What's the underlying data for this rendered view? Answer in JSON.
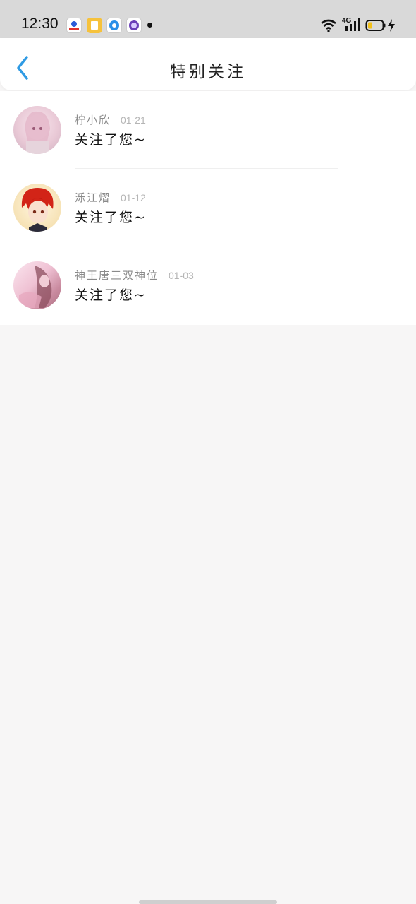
{
  "status_bar": {
    "time": "12:30",
    "network": "4G",
    "icons": [
      "baidu-app-icon",
      "notes-app-icon",
      "browser-app-icon",
      "messenger-app-icon",
      "wifi-icon",
      "cellular-signal-icon",
      "battery-icon",
      "charging-icon"
    ]
  },
  "header": {
    "title": "特别关注",
    "back_icon": "chevron-left-icon"
  },
  "colors": {
    "accent": "#2f9be4",
    "background": "#f7f6f6",
    "status_bar": "#d9d9d9"
  },
  "items": [
    {
      "name": "柠小欣",
      "date": "01-21",
      "message": "关注了您~",
      "avatar": "avatar-pink-hair"
    },
    {
      "name": "泺江熠",
      "date": "01-12",
      "message": "关注了您~",
      "avatar": "avatar-red-hair"
    },
    {
      "name": "神王唐三双神位",
      "date": "01-03",
      "message": "关注了您~",
      "avatar": "avatar-pink-scene"
    }
  ]
}
